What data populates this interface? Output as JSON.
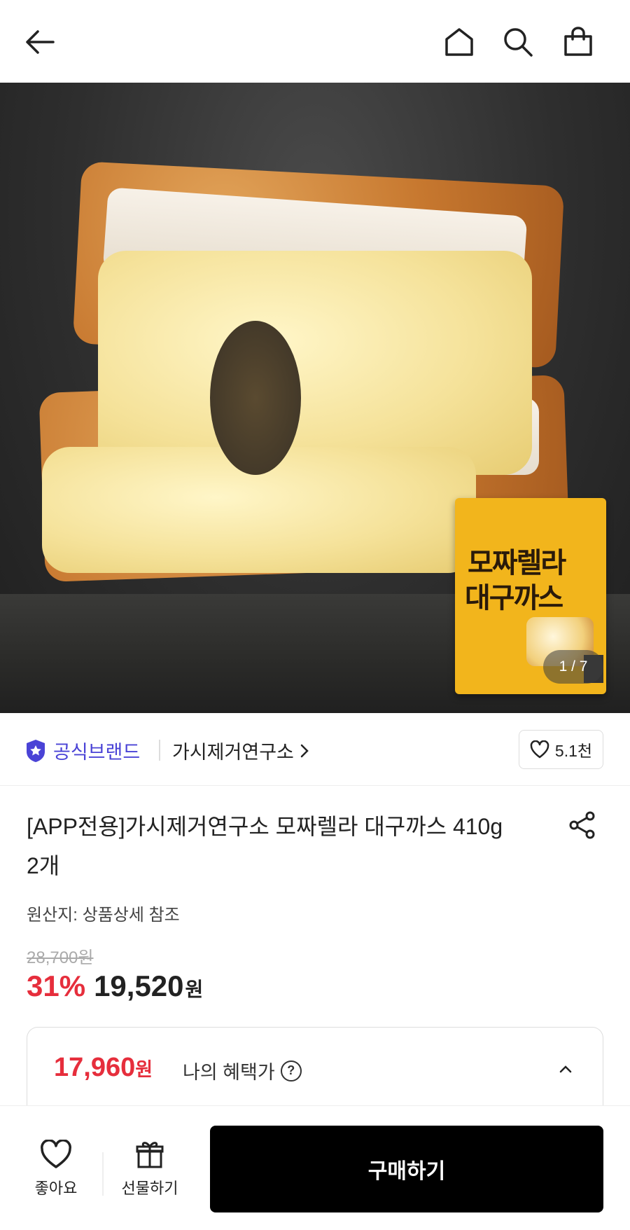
{
  "topbar": {
    "icons": [
      "back-arrow-icon",
      "home-icon",
      "search-icon",
      "shopping-bag-icon"
    ]
  },
  "hero": {
    "image": "mozzarella-cod-cutlet-photo",
    "package_text_line1": "모짜렐라",
    "package_text_line2": "대구까스",
    "counter": "1 / 7"
  },
  "brand": {
    "official_label": "공식브랜드",
    "name": "가시제거연구소",
    "likes": "5.1천"
  },
  "product": {
    "title": "[APP전용]가시제거연구소 모짜렐라 대구까스 410g 2개",
    "origin": "원산지: 상품상세 참조",
    "original_price": "28,700원",
    "discount": "31%",
    "price": "19,520",
    "won": "원"
  },
  "benefit": {
    "price": "17,960",
    "won": "원",
    "label": "나의 혜택가",
    "help": "?"
  },
  "bottom": {
    "like_label": "좋아요",
    "gift_label": "선물하기",
    "buy_label": "구매하기"
  },
  "colors": {
    "accent_red": "#e62e3c",
    "brand_purple": "#4a43d6",
    "buy_button": "#000000"
  }
}
